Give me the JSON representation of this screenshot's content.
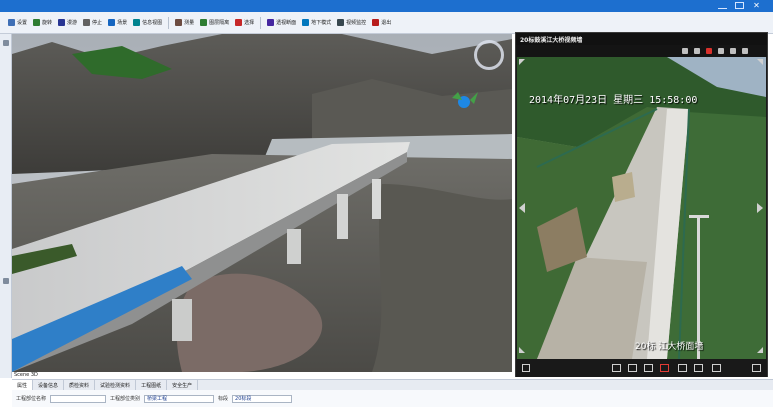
{
  "toolbar": {
    "items": [
      {
        "label": "设置",
        "icon": "gear-icon",
        "color": "#3f6fb5"
      },
      {
        "label": "旋转",
        "icon": "rotate-icon",
        "color": "#2e7d32"
      },
      {
        "label": "漫游",
        "icon": "walk-icon",
        "color": "#283593"
      },
      {
        "label": "停止",
        "icon": "stop-icon",
        "color": "#616161"
      },
      {
        "label": "场景",
        "icon": "scene-icon",
        "color": "#1565c0"
      },
      {
        "label": "信息视图",
        "icon": "info-view-icon",
        "color": "#00838f"
      },
      {
        "label": "测量",
        "icon": "measure-icon",
        "color": "#6d4c41"
      },
      {
        "label": "图层隔离",
        "icon": "layer-isolate-icon",
        "color": "#2e7d32"
      },
      {
        "label": "选择",
        "icon": "select-icon",
        "color": "#c62828"
      },
      {
        "label": "透视断面",
        "icon": "section-icon",
        "color": "#4527a0"
      },
      {
        "label": "地下模式",
        "icon": "underground-icon",
        "color": "#0277bd"
      },
      {
        "label": "视频监控",
        "icon": "video-monitor-icon",
        "color": "#37474f"
      },
      {
        "label": "退出",
        "icon": "exit-icon",
        "color": "#b71c1c"
      }
    ]
  },
  "video": {
    "title": "20标鼓溪江大桥视频墙",
    "timestamp": "2014年07月23日  星期三  15:58:00",
    "caption": "20标  江大桥面墙"
  },
  "view3d": {
    "label": "Scene 3D"
  },
  "tabs": [
    {
      "label": "属性"
    },
    {
      "label": "设备信息"
    },
    {
      "label": "质检资料"
    },
    {
      "label": "试验检测资料"
    },
    {
      "label": "工程图纸"
    },
    {
      "label": "安全生产"
    }
  ],
  "form": {
    "field1_label": "工程部位名称",
    "field1_value": "",
    "field2_label": "工程部位类别",
    "field2_value": "桥梁工程",
    "field3_label": "标段",
    "field3_value": "20标段"
  }
}
